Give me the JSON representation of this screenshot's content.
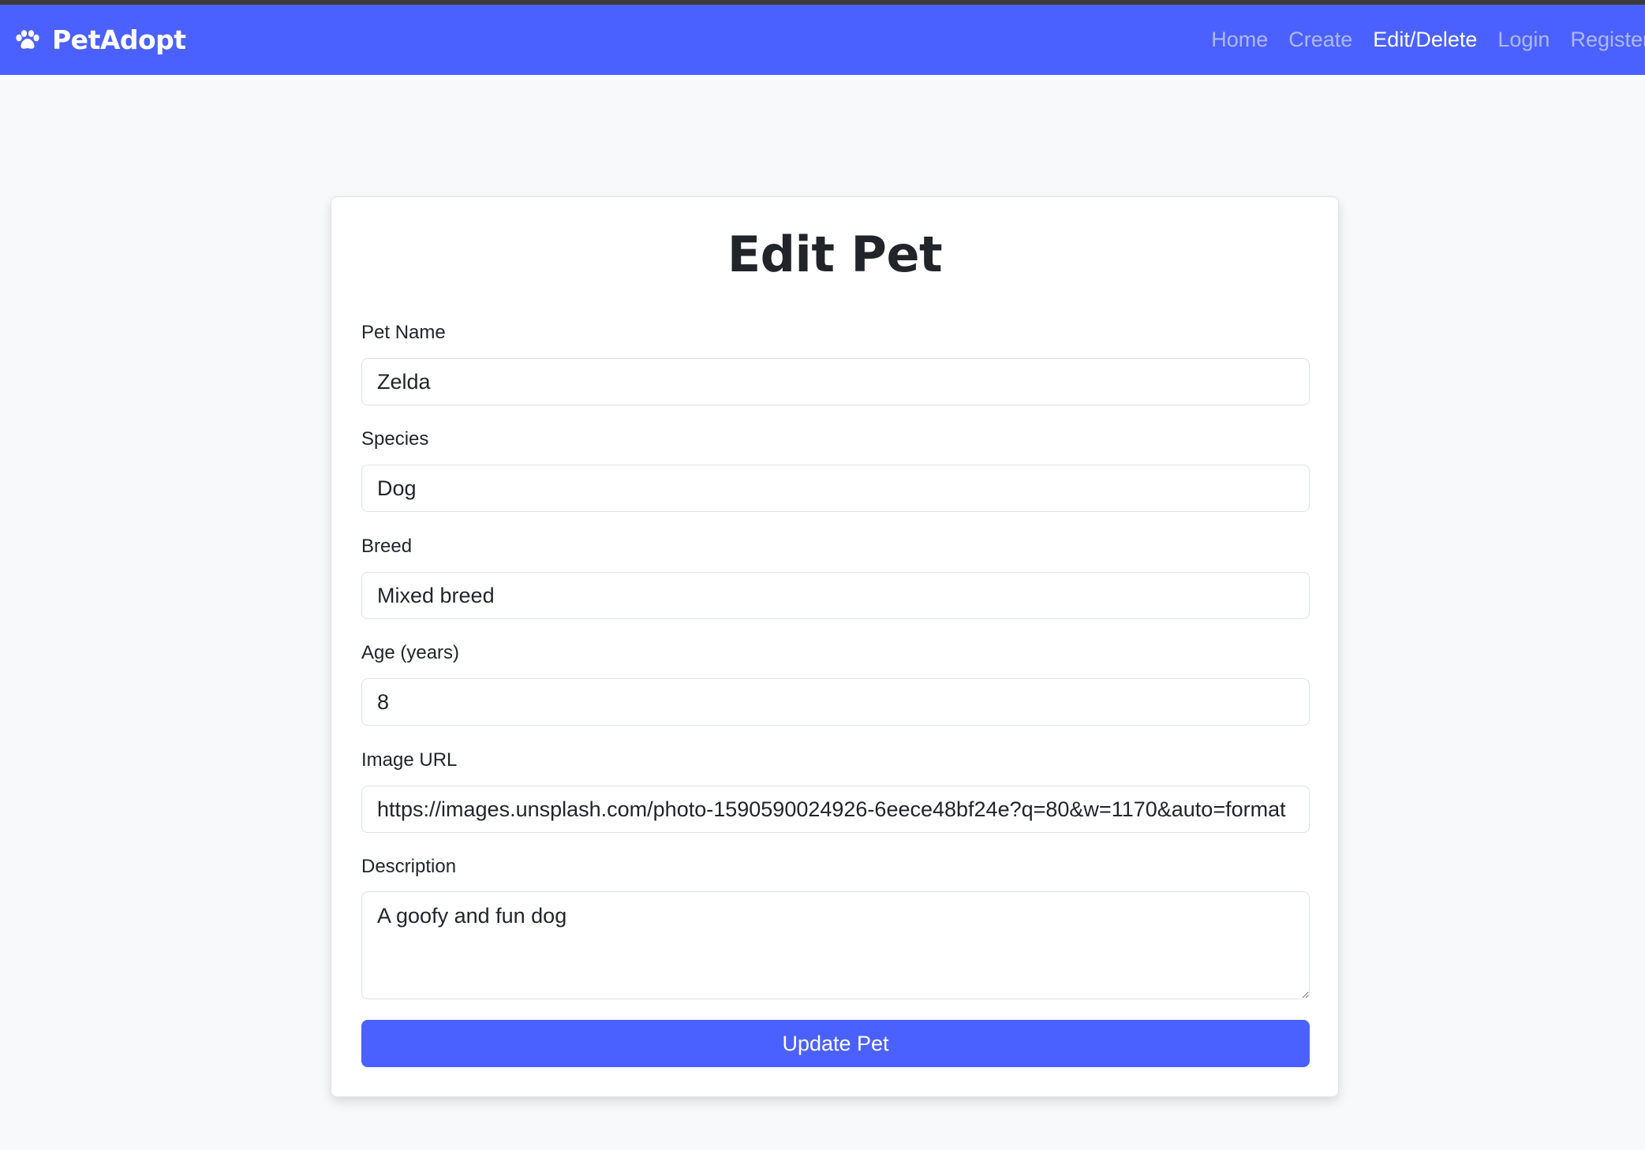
{
  "navbar": {
    "brand_icon": "paw-icon",
    "brand_name": "PetAdopt",
    "links": [
      {
        "label": "Home",
        "active": false
      },
      {
        "label": "Create",
        "active": false
      },
      {
        "label": "Edit/Delete",
        "active": true
      },
      {
        "label": "Login",
        "active": false
      },
      {
        "label": "Register",
        "active": false
      }
    ]
  },
  "form": {
    "title": "Edit Pet",
    "fields": {
      "pet_name": {
        "label": "Pet Name",
        "value": "Zelda"
      },
      "species": {
        "label": "Species",
        "value": "Dog"
      },
      "breed": {
        "label": "Breed",
        "value": "Mixed breed"
      },
      "age": {
        "label": "Age (years)",
        "value": "8"
      },
      "image_url": {
        "label": "Image URL",
        "value": "https://images.unsplash.com/photo-1590590024926-6eece48bf24e?q=80&w=1170&auto=format"
      },
      "description": {
        "label": "Description",
        "value": "A goofy and fun dog"
      }
    },
    "submit_label": "Update Pet"
  },
  "colors": {
    "primary": "#4b61ff",
    "page_background": "#f8f9fa",
    "text": "#212529"
  }
}
